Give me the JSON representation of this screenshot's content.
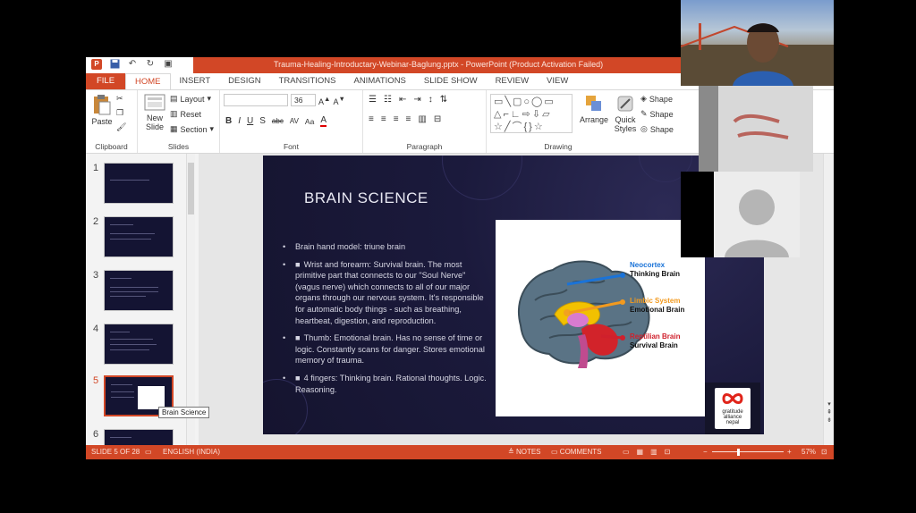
{
  "window": {
    "title": "Trauma-Healing-Introductary-Webinar-Baglung.pptx  -  PowerPoint (Product Activation Failed)"
  },
  "tabs": [
    "FILE",
    "HOME",
    "INSERT",
    "DESIGN",
    "TRANSITIONS",
    "ANIMATIONS",
    "SLIDE SHOW",
    "REVIEW",
    "VIEW"
  ],
  "ribbon": {
    "clipboard": {
      "paste": "Paste",
      "group": "Clipboard"
    },
    "slides": {
      "new_slide_1": "New",
      "new_slide_2": "Slide",
      "layout": "Layout",
      "reset": "Reset",
      "section": "Section",
      "group": "Slides"
    },
    "font": {
      "size": "36",
      "group": "Font",
      "bold": "B",
      "italic": "I",
      "underline": "U",
      "shadow": "S",
      "strike": "abc",
      "spacing": "AV",
      "case": "Aa",
      "color": "A"
    },
    "paragraph": {
      "group": "Paragraph"
    },
    "drawing": {
      "arrange": "Arrange",
      "quick_1": "Quick",
      "quick_2": "Styles",
      "shape_fill": "Shape",
      "shape_outline": "Shape",
      "shape_effects": "Shape",
      "group": "Drawing"
    }
  },
  "thumbnails": [
    {
      "num": "1"
    },
    {
      "num": "2"
    },
    {
      "num": "3"
    },
    {
      "num": "4"
    },
    {
      "num": "5"
    },
    {
      "num": "6"
    }
  ],
  "tooltip": "Brain Science",
  "slide": {
    "title": "BRAIN SCIENCE",
    "bullets": [
      "Brain hand model: triune brain",
      "Wrist and forearm: Survival brain. The most primitive part that connects to our \"Soul Nerve\" (vagus nerve) which connects to all of our major organs through our nervous system. It's responsible for automatic body things - such as breathing, heartbeat, digestion, and reproduction.",
      "Thumb: Emotional brain. Has no sense of time or logic. Constantly scans for danger. Stores emotional memory of trauma.",
      "4 fingers: Thinking brain. Rational thoughts. Logic. Reasoning."
    ],
    "bullet_marker": "■",
    "brain_labels": [
      {
        "name": "Neocortex",
        "desc": "Thinking Brain",
        "color": "#1a73d8"
      },
      {
        "name": "Limbic System",
        "desc": "Emotional Brain",
        "color": "#f29a1f"
      },
      {
        "name": "Reptilian Brain",
        "desc": "Survival Brain",
        "color": "#d0202c"
      }
    ],
    "logo_lines": [
      "gratitude",
      "alliance",
      "nepal"
    ]
  },
  "status": {
    "slide_info": "SLIDE 5 OF 28",
    "language": "ENGLISH (INDIA)",
    "notes": "NOTES",
    "comments": "COMMENTS",
    "zoom": "57%"
  },
  "colors": {
    "accent": "#d24726",
    "slide_bg": "#1b1a3c"
  }
}
